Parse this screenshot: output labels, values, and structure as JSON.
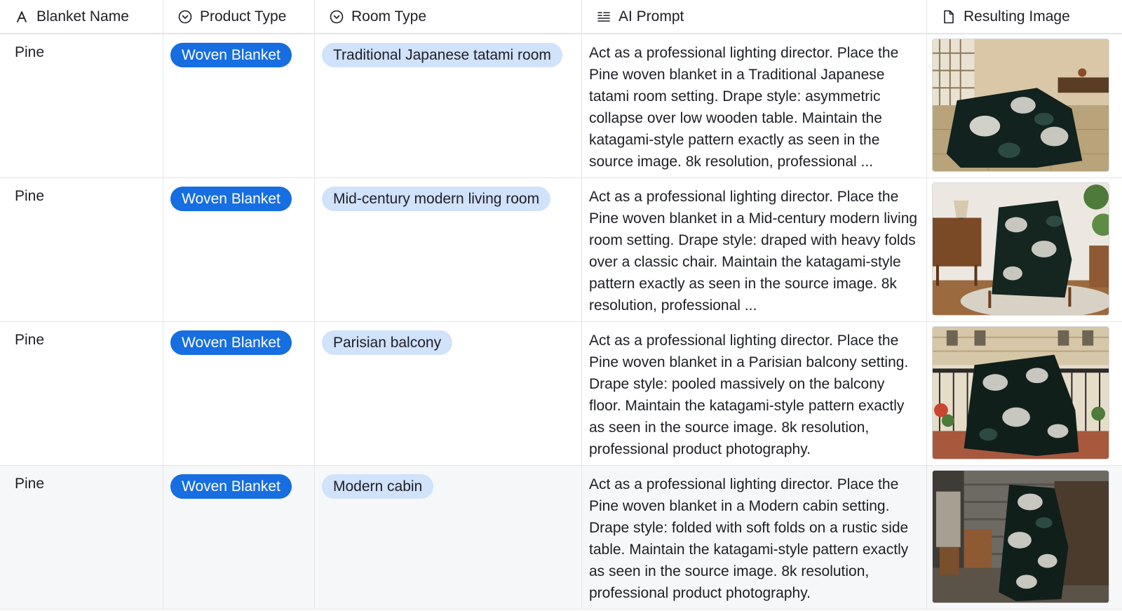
{
  "columns": {
    "name": {
      "label": "Blanket Name",
      "icon": "text-a-icon"
    },
    "product": {
      "label": "Product Type",
      "icon": "single-select-icon"
    },
    "room": {
      "label": "Room Type",
      "icon": "single-select-icon"
    },
    "prompt": {
      "label": "AI Prompt",
      "icon": "long-text-icon"
    },
    "image": {
      "label": "Resulting Image",
      "icon": "attachment-file-icon"
    }
  },
  "rows": [
    {
      "name": "Pine",
      "product": "Woven Blanket",
      "room": "Traditional Japanese tatami room",
      "prompt": "Act as a professional lighting director. Place the Pine woven blanket in a Traditional Japanese tatami room setting. Drape style: asymmetric collapse over low wooden table. Maintain the katagami-style pattern exactly as seen in the source image. 8k resolution, professional ...",
      "image": "blanket-on-low-table-tatami-photo"
    },
    {
      "name": "Pine",
      "product": "Woven Blanket",
      "room": "Mid-century modern living room",
      "prompt": "Act as a professional lighting director. Place the Pine woven blanket in a Mid-century modern living room setting. Drape style: draped with heavy folds over a classic chair. Maintain the katagami-style pattern exactly as seen in the source image. 8k resolution, professional ...",
      "image": "blanket-on-chair-living-room-photo"
    },
    {
      "name": "Pine",
      "product": "Woven Blanket",
      "room": "Parisian balcony",
      "prompt": "Act as a professional lighting director. Place the Pine woven blanket in a Parisian balcony setting. Drape style: pooled massively on the balcony floor. Maintain the katagami-style pattern exactly as seen in the source image. 8k resolution, professional product photography.",
      "image": "blanket-on-balcony-photo"
    },
    {
      "name": "Pine",
      "product": "Woven Blanket",
      "room": "Modern cabin",
      "prompt": "Act as a professional lighting director. Place the Pine woven blanket in a Modern cabin setting. Drape style: folded with soft folds on a rustic side table. Maintain the katagami-style pattern exactly as seen in the source image. 8k resolution, professional product photography.",
      "image": "blanket-on-side-table-cabin-photo"
    }
  ],
  "colors": {
    "pill_primary": "#166ee1",
    "pill_secondary": "#d1e2fb",
    "border": "#e3e5e8",
    "row_hover": "#f6f7f8"
  }
}
